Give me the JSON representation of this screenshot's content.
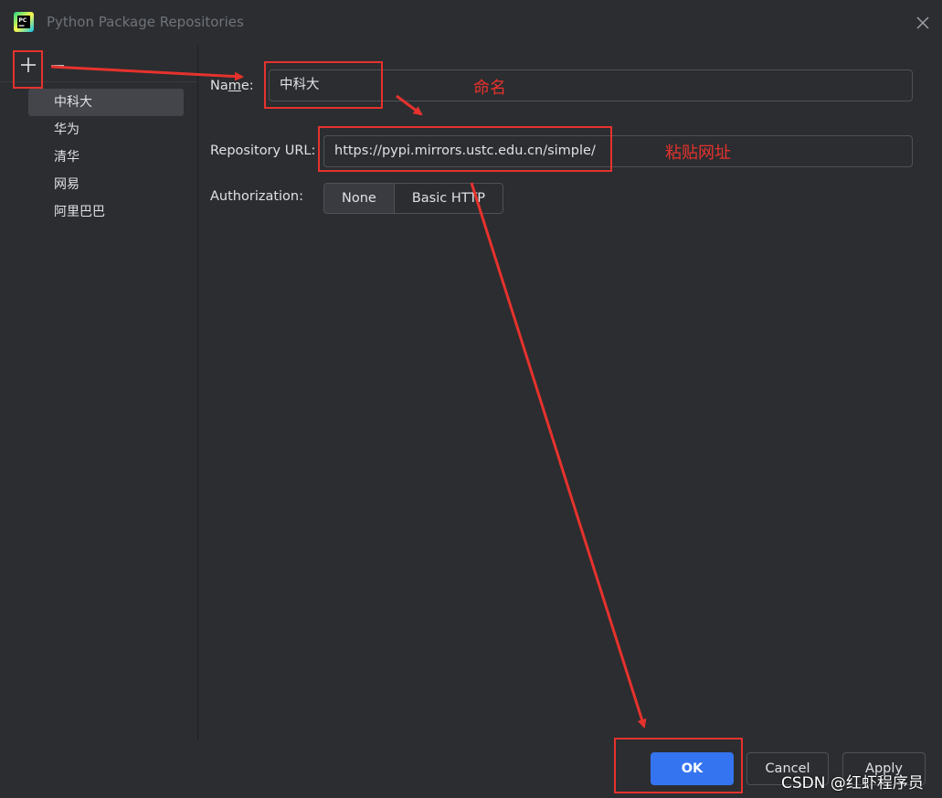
{
  "window": {
    "title": "Python Package Repositories",
    "app_icon": "pycharm-icon",
    "close_icon": "close-icon"
  },
  "sidebar": {
    "add_icon": "plus-icon",
    "remove_icon": "minus-icon",
    "items": [
      {
        "label": "中科大",
        "selected": true
      },
      {
        "label": "华为"
      },
      {
        "label": "清华"
      },
      {
        "label": "网易"
      },
      {
        "label": "阿里巴巴"
      }
    ]
  },
  "form": {
    "name_label_pre": "Na",
    "name_label_mnemonic": "m",
    "name_label_post": "e:",
    "name_value": "中科大",
    "url_label": "Repository URL:",
    "url_value": "https://pypi.mirrors.ustc.edu.cn/simple/",
    "auth_label": "Authorization:",
    "auth_options": [
      "None",
      "Basic HTTP"
    ],
    "auth_selected": "None"
  },
  "buttons": {
    "ok": "OK",
    "cancel": "Cancel",
    "apply": "Apply"
  },
  "annotations": {
    "name_note": "命名",
    "url_note": "粘贴网址",
    "color": "#e6322d"
  },
  "watermark": "CSDN @红虾程序员",
  "colors": {
    "background": "#2b2d30",
    "accent": "#3574f0",
    "border": "#4e5157",
    "selection": "#43454a"
  }
}
